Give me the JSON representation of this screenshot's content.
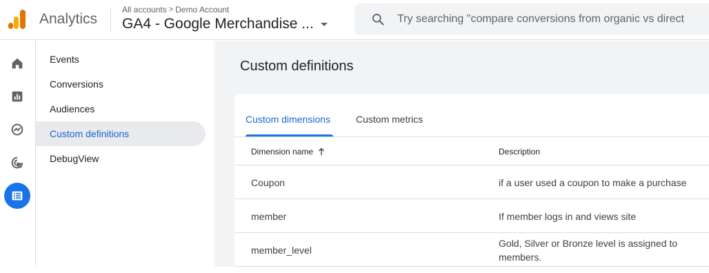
{
  "header": {
    "app_name": "Analytics",
    "breadcrumb": {
      "root": "All accounts",
      "separator": ">",
      "account": "Demo Account"
    },
    "property_name": "GA4 - Google Merchandise ...",
    "search_placeholder": "Try searching \"compare conversions from organic vs direct"
  },
  "rail": {
    "items": [
      {
        "icon": "home-icon"
      },
      {
        "icon": "reports-icon"
      },
      {
        "icon": "explore-icon"
      },
      {
        "icon": "advertising-icon"
      },
      {
        "icon": "configure-icon",
        "active": true
      }
    ]
  },
  "subnav": {
    "items": [
      {
        "label": "Events"
      },
      {
        "label": "Conversions"
      },
      {
        "label": "Audiences"
      },
      {
        "label": "Custom definitions",
        "active": true
      },
      {
        "label": "DebugView"
      }
    ]
  },
  "main": {
    "title": "Custom definitions",
    "tabs": [
      {
        "label": "Custom dimensions",
        "active": true
      },
      {
        "label": "Custom metrics"
      }
    ],
    "table": {
      "columns": [
        {
          "label": "Dimension name",
          "sort": "ascending"
        },
        {
          "label": "Description"
        }
      ],
      "rows": [
        {
          "name": "Coupon",
          "description": "if a user used a coupon to make a purchase"
        },
        {
          "name": "member",
          "description": "If member logs in and views site"
        },
        {
          "name": "member_level",
          "description": "Gold, Silver or Bronze level is assigned to members."
        }
      ]
    }
  },
  "colors": {
    "accent": "#1a73e8",
    "logo_dark": "#e37400",
    "logo_light": "#f9ab00",
    "main_bg": "#f1f3f4"
  }
}
